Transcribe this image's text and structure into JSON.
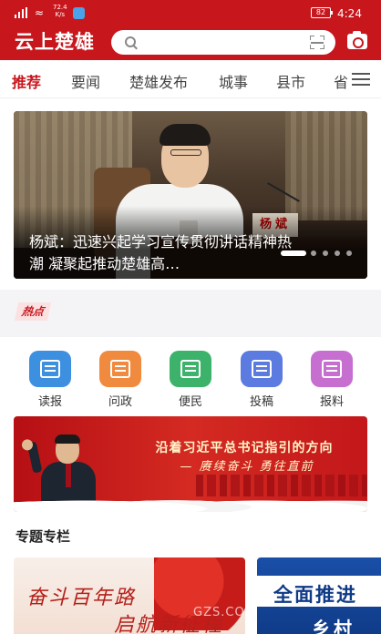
{
  "status_bar": {
    "speed_value": "72.4",
    "speed_unit": "K/s",
    "battery": "82",
    "time": "4:24"
  },
  "header": {
    "logo": "云上楚雄",
    "search_placeholder": ""
  },
  "tabs": [
    {
      "label": "推荐",
      "active": true
    },
    {
      "label": "要闻",
      "active": false
    },
    {
      "label": "楚雄发布",
      "active": false
    },
    {
      "label": "城事",
      "active": false
    },
    {
      "label": "县市",
      "active": false
    },
    {
      "label": "省",
      "active": false
    }
  ],
  "banner": {
    "nameplate": "杨斌",
    "caption": "杨斌：迅速兴起学习宣传贯彻讲话精神热潮 凝聚起推动楚雄高…",
    "slide_count": 5,
    "active_slide": 1
  },
  "hot": {
    "tag": "热点"
  },
  "quick_entries": [
    {
      "label": "读报",
      "icon": "newspaper-icon",
      "color": "#3d8fe0"
    },
    {
      "label": "问政",
      "icon": "question-message-icon",
      "color": "#f08a3e"
    },
    {
      "label": "便民",
      "icon": "home-icon",
      "color": "#3cb26b"
    },
    {
      "label": "投稿",
      "icon": "submit-document-icon",
      "color": "#5b7be0"
    },
    {
      "label": "报料",
      "icon": "chat-bubble-icon",
      "color": "#c66fd0"
    }
  ],
  "promo": {
    "slogan": "沿着习近平总书记指引的方向",
    "sub": "— 赓续奋斗 勇往直前"
  },
  "columns": {
    "title": "专题专栏",
    "cards": [
      {
        "line1": "奋斗百年路",
        "line2": "启航新征程"
      },
      {
        "line1": "全面推进",
        "line2": "乡村"
      }
    ]
  },
  "watermark": "GZS.COM"
}
